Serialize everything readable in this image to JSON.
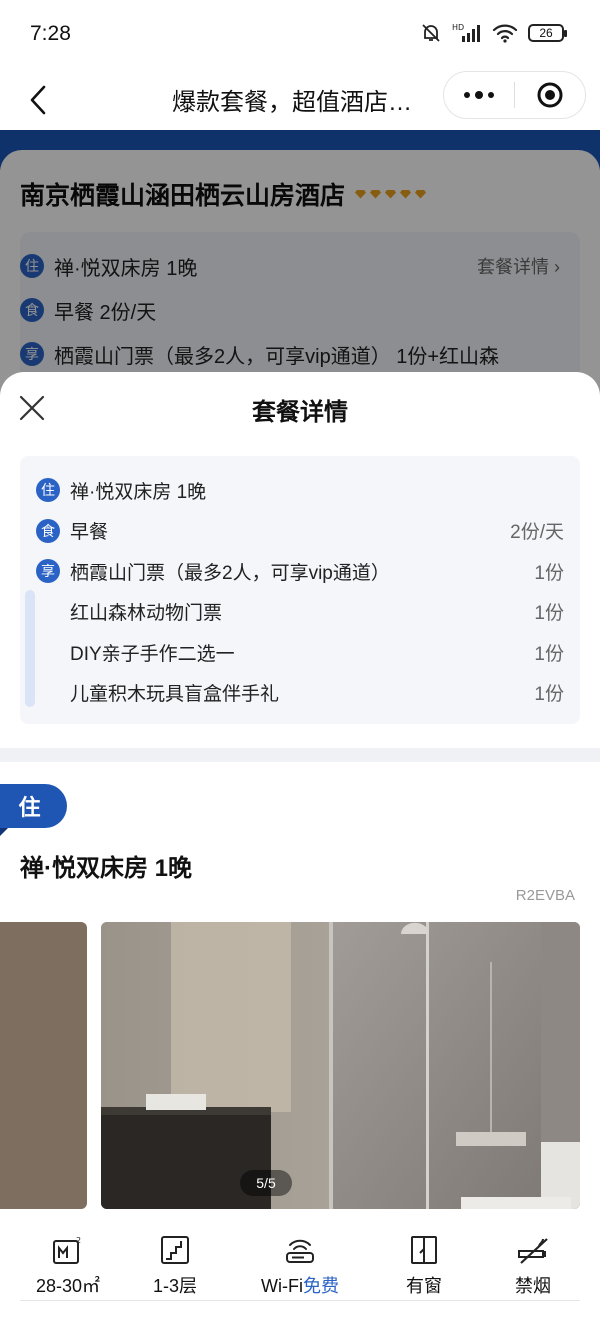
{
  "status_bar": {
    "time": "7:28",
    "battery": "26",
    "network_label": "HD"
  },
  "nav": {
    "title": "爆款套餐，超值酒店…"
  },
  "background_page": {
    "hotel_name": "南京栖霞山涵田栖云山房酒店",
    "rows": [
      {
        "badge": "住",
        "text": "禅·悦双床房 1晚",
        "link": "套餐详情 ›"
      },
      {
        "badge": "食",
        "text": "早餐 2份/天"
      },
      {
        "badge": "享",
        "text": "栖霞山门票（最多2人，可享vip通道） 1份+红山森"
      }
    ]
  },
  "sheet": {
    "title": "套餐详情",
    "items": [
      {
        "badge": "住",
        "name": "禅·悦双床房 1晚",
        "qty": ""
      },
      {
        "badge": "食",
        "name": "早餐",
        "qty": "2份/天"
      },
      {
        "badge": "享",
        "name": "栖霞山门票（最多2人，可享vip通道）",
        "qty": "1份"
      },
      {
        "badge": "",
        "name": "红山森林动物门票",
        "qty": "1份"
      },
      {
        "badge": "",
        "name": "DIY亲子手作二选一",
        "qty": "1份"
      },
      {
        "badge": "",
        "name": "儿童积木玩具盲盒伴手礼",
        "qty": "1份"
      }
    ],
    "room": {
      "tag": "住",
      "name": "禅·悦双床房 1晚",
      "code": "R2EVBA",
      "photo_counter": "5/5"
    },
    "facilities": [
      {
        "icon": "area-icon",
        "label": "28-30㎡"
      },
      {
        "icon": "floor-icon",
        "label": "1-3层"
      },
      {
        "icon": "wifi-router-icon",
        "label": "Wi-Fi",
        "highlight": "免费"
      },
      {
        "icon": "window-icon",
        "label": "有窗"
      },
      {
        "icon": "no-smoking-icon",
        "label": "禁烟"
      }
    ]
  },
  "colors": {
    "brand_blue": "#2a63c5",
    "tag_blue": "#1f56b3",
    "diamond": "#e9a020"
  }
}
